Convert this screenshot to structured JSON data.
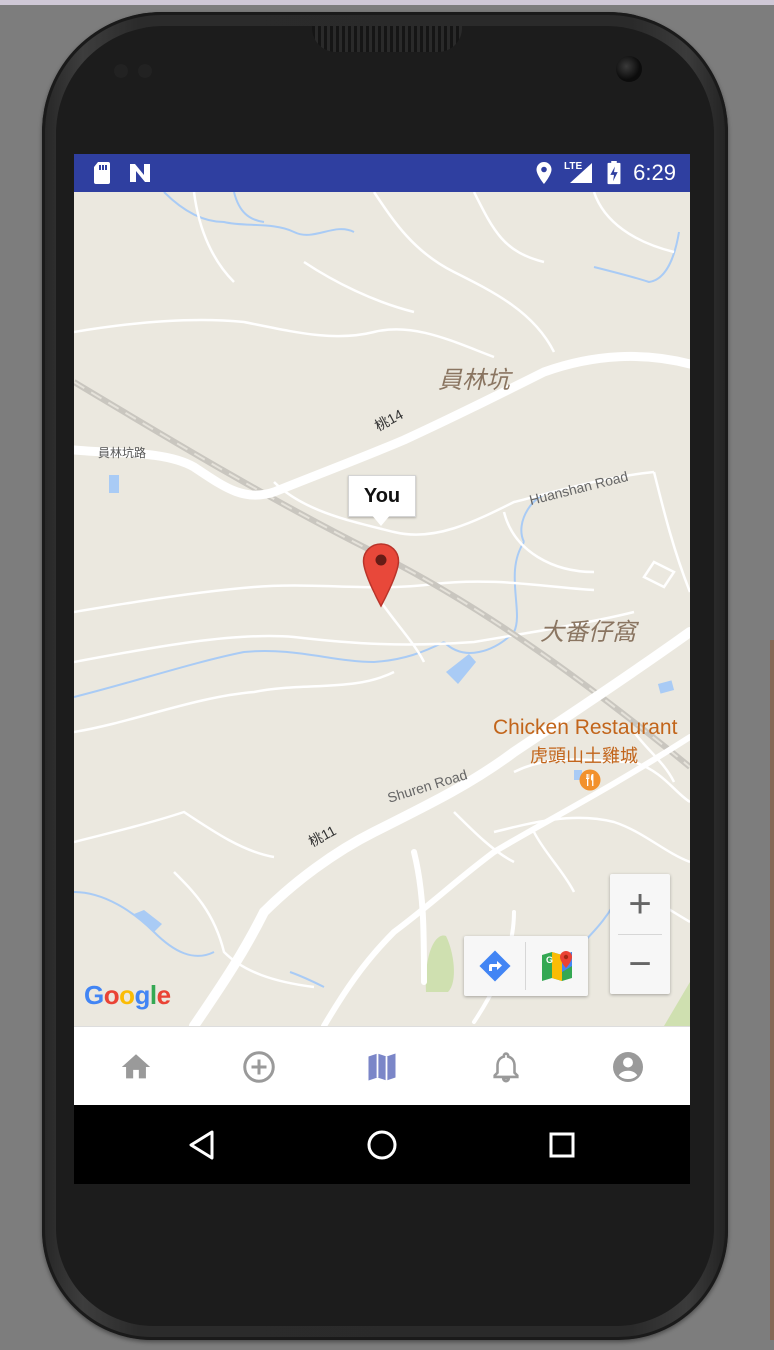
{
  "status_bar": {
    "time": "6:29",
    "left_icons": [
      "sd-card-icon",
      "n-notification-icon"
    ],
    "right_icons": [
      "location-icon",
      "lte-signal-icon",
      "battery-charging-icon"
    ],
    "network_label": "LTE",
    "background_color": "#2f3fa0"
  },
  "map": {
    "marker_title": "You",
    "labels": {
      "village_1": "員林坑",
      "village_2": "大番仔窩",
      "road_1": "員林坑路",
      "road_2": "桃14",
      "road_3": "Huanshan Road",
      "road_4": "Shuren Road",
      "road_5": "桃11",
      "poi_name_en": "Chicken Restaurant",
      "poi_name_zh": "虎頭山土雞城"
    },
    "attribution": "Google",
    "zoom_in_label": "+",
    "zoom_out_label": "−",
    "colors": {
      "land": "#ebe8df",
      "road": "#ffffff",
      "water": "#a9cbf5",
      "park": "#cfe0b0",
      "marker": "#e8483a",
      "poi": "#f2912d",
      "poi_text": "#c2651b",
      "place_text": "#8a7561"
    }
  },
  "bottom_nav": {
    "items": [
      {
        "name": "home",
        "icon": "home-icon",
        "active": false
      },
      {
        "name": "add",
        "icon": "add-circle-icon",
        "active": false
      },
      {
        "name": "map",
        "icon": "map-icon",
        "active": true
      },
      {
        "name": "notifications",
        "icon": "bell-icon",
        "active": false
      },
      {
        "name": "account",
        "icon": "account-circle-icon",
        "active": false
      }
    ],
    "active_color": "#7b86c8",
    "inactive_color": "#9a9a9a"
  },
  "system_nav": {
    "buttons": [
      "back-icon",
      "home-circle-icon",
      "recents-icon"
    ]
  }
}
